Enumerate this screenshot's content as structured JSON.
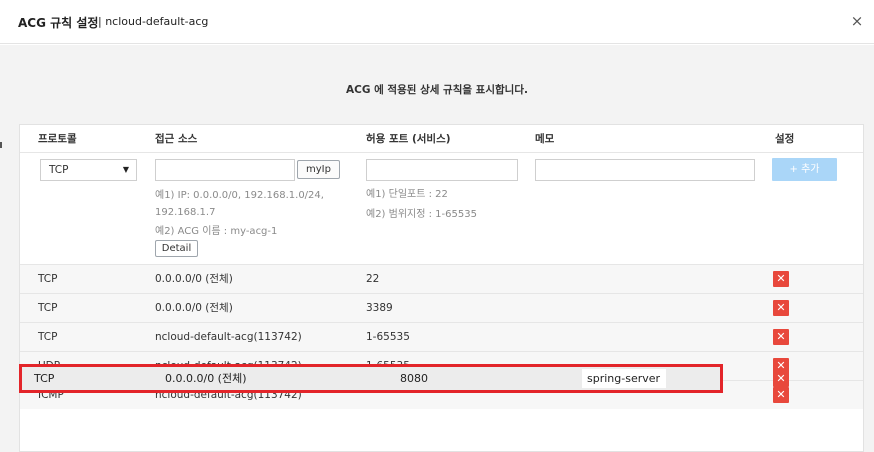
{
  "title": {
    "main": "ACG 규칙 설정",
    "sub": "| ncloud-default-acg",
    "close": "×"
  },
  "description": "ACG 에 적용된 상세 규칙을 표시합니다.",
  "headers": {
    "protocol": "프로토콜",
    "source": "접근 소스",
    "port": "허용 포트 (서비스)",
    "memo": "메모",
    "settings": "설정"
  },
  "form": {
    "protocol_selected": "TCP",
    "caret": "▼",
    "myip_label": "myIp",
    "add_label": "+ 추가",
    "source_hint_1a": "예1) IP: 0.0.0.0/0, 192.168.1.0/24,",
    "source_hint_1b": "192.168.1.7",
    "source_hint_2": "예2) ACG 이름 : my-acg-1",
    "detail_label": "Detail",
    "port_hint_1": "예1) 단일포트 : 22",
    "port_hint_2": "예2) 범위지정 : 1-65535"
  },
  "rules": [
    {
      "protocol": "TCP",
      "source": "0.0.0.0/0 (전체)",
      "port": "22",
      "memo": ""
    },
    {
      "protocol": "TCP",
      "source": "0.0.0.0/0 (전체)",
      "port": "3389",
      "memo": ""
    },
    {
      "protocol": "TCP",
      "source": "ncloud-default-acg(113742)",
      "port": "1-65535",
      "memo": ""
    },
    {
      "protocol": "UDP",
      "source": "ncloud-default-acg(113742)",
      "port": "1-65535",
      "memo": ""
    },
    {
      "protocol": "ICMP",
      "source": "ncloud-default-acg(113742)",
      "port": "",
      "memo": ""
    }
  ],
  "new_rule": {
    "protocol": "TCP",
    "source": "0.0.0.0/0 (전체)",
    "port": "8080",
    "memo": "spring-server"
  },
  "delete_glyph": "✕",
  "colors": {
    "delete": "#e8483c",
    "highlight": "#e3252a",
    "add_button": "#aad6f8"
  }
}
